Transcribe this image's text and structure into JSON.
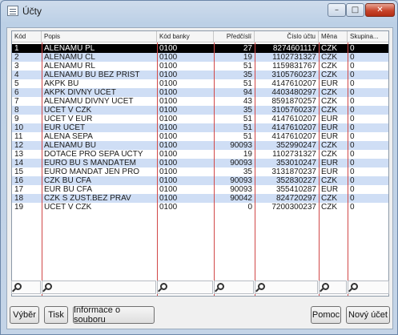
{
  "window": {
    "title": "Účty"
  },
  "titlebar": {
    "minimize": "–",
    "maximize": "□",
    "close": "✕"
  },
  "columns": [
    "Kód",
    "Popis",
    "Kód banky",
    "Předčíslí",
    "Číslo účtu",
    "Měna",
    "Skupina..."
  ],
  "rows": [
    [
      "1",
      "ALENAMU PL",
      "0100",
      "27",
      "8274601117",
      "CZK",
      "0"
    ],
    [
      "2",
      "ALENAMU CL",
      "0100",
      "19",
      "1102731327",
      "CZK",
      "0"
    ],
    [
      "3",
      "ALENAMU RL",
      "0100",
      "51",
      "1159831767",
      "CZK",
      "0"
    ],
    [
      "4",
      "ALENAMU BU BEZ PRIST",
      "0100",
      "35",
      "3105760237",
      "CZK",
      "0"
    ],
    [
      "5",
      "AKPK BU",
      "0100",
      "51",
      "4147610207",
      "EUR",
      "0"
    ],
    [
      "6",
      "AKPK DIVNY ÚČET",
      "0100",
      "94",
      "4403480297",
      "CZK",
      "0"
    ],
    [
      "7",
      "ALENAMU DIVNY UCET",
      "0100",
      "43",
      "8591870257",
      "CZK",
      "0"
    ],
    [
      "8",
      "ÚČET V CZK",
      "0100",
      "35",
      "3105760237",
      "CZK",
      "0"
    ],
    [
      "9",
      "ÚČET V EUR",
      "0100",
      "51",
      "4147610207",
      "EUR",
      "0"
    ],
    [
      "10",
      "EUR ÚČET",
      "0100",
      "51",
      "4147610207",
      "EUR",
      "0"
    ],
    [
      "11",
      "ALENA SEPA",
      "0100",
      "51",
      "4147610207",
      "EUR",
      "0"
    ],
    [
      "12",
      "ALENAMU BU",
      "0100",
      "90093",
      "352990247",
      "CZK",
      "0"
    ],
    [
      "13",
      "DOTACE PRO SEPA ÚČTY",
      "0100",
      "19",
      "1102731327",
      "CZK",
      "0"
    ],
    [
      "14",
      "EURO BU S MANDÁTEM",
      "0100",
      "90093",
      "353010247",
      "EUR",
      "0"
    ],
    [
      "15",
      "EURO MANDAT JEN PRO",
      "0100",
      "35",
      "3131870237",
      "EUR",
      "0"
    ],
    [
      "16",
      "CZK BU CFA",
      "0100",
      "90093",
      "352830227",
      "CZK",
      "0"
    ],
    [
      "17",
      "EUR BU CFA",
      "0100",
      "90093",
      "355410287",
      "EUR",
      "0"
    ],
    [
      "18",
      "CZK S ZUST.BEZ PRAV",
      "0100",
      "90042",
      "824720297",
      "CZK",
      "0"
    ],
    [
      "19",
      "ÚČET V CZK",
      "0100",
      "0",
      "7200300237",
      "CZK",
      "0"
    ]
  ],
  "selected_row": 1,
  "buttons": {
    "vyber": "Výběr",
    "tisk": "Tisk",
    "info": "Informace o souboru",
    "pomoc": "Pomoc",
    "novy": "Nový účet"
  },
  "colors": {
    "row_alt": "#cfdef5",
    "selected": "#000000",
    "column_line": "#d14848"
  }
}
